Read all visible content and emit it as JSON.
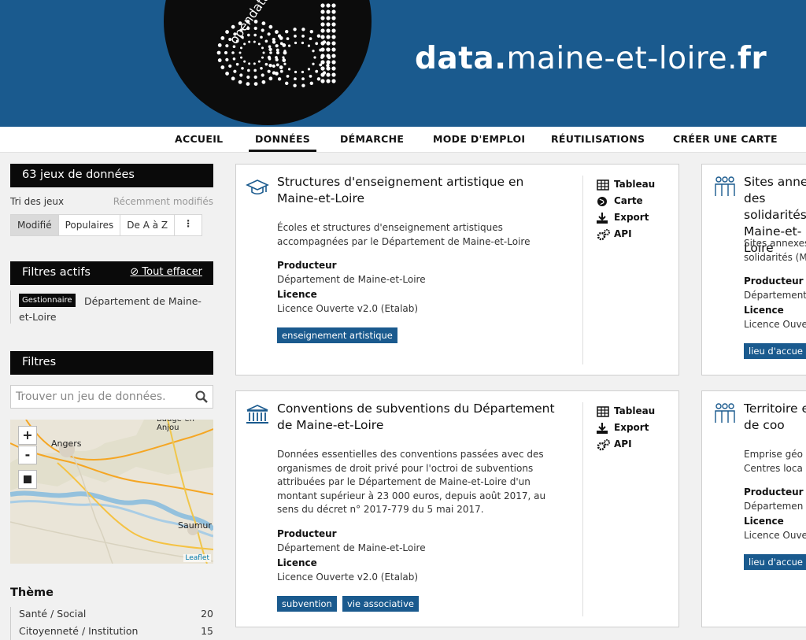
{
  "header": {
    "logo_text": "opendata",
    "site_title_bold": "data.",
    "site_title_mid": "maine-et-loire.",
    "site_title_end": "fr"
  },
  "nav": [
    "ACCUEIL",
    "DONNÉES",
    "DÉMARCHE",
    "MODE D'EMPLOI",
    "RÉUTILISATIONS",
    "CRÉER UNE CARTE"
  ],
  "sidebar": {
    "count_label": "63 jeux de données",
    "sort_label": "Tri des jeux",
    "sort_current": "Récemment modifiés",
    "sort_options": [
      "Modifié",
      "Populaires",
      "De A à Z",
      "⋮"
    ],
    "active_filters_title": "Filtres actifs",
    "clear_all": "Tout effacer",
    "filter_tag": "Gestionnaire",
    "filter_value": "Département de Maine-et-Loire",
    "filters_title": "Filtres",
    "search_placeholder": "Trouver un jeu de données.",
    "map": {
      "zoom_in": "+",
      "zoom_out": "-",
      "labels": [
        "Angers",
        "Saumur",
        "Baugé-en-Anjou"
      ],
      "attribution": "Leaflet"
    },
    "theme_title": "Thème",
    "themes": [
      {
        "name": "Santé / Social",
        "count": "20"
      },
      {
        "name": "Citoyenneté / Institution",
        "count": "15"
      }
    ]
  },
  "cards": [
    {
      "title": "Structures d'enseignement artistique en Maine-et-Loire",
      "description": "Écoles et structures d'enseignement artistiques accompagnées par le Département de Maine-et-Loire",
      "producer_label": "Producteur",
      "producer": "Département de Maine-et-Loire",
      "license_label": "Licence",
      "license": "Licence Ouverte v2.0 (Etalab)",
      "keywords": [
        "enseignement artistique"
      ],
      "actions": [
        "Tableau",
        "Carte",
        "Export",
        "API"
      ]
    },
    {
      "title": "Conventions de subventions du Département de Maine-et-Loire",
      "description": "Données essentielles des conventions passées avec des organismes de droit privé pour l'octroi de subventions attribuées par le Département de Maine-et-Loire d'un montant supérieur à 23 000 euros, depuis août 2017, au sens du décret n° 2017-779 du 5 mai 2017.",
      "producer_label": "Producteur",
      "producer": "Département de Maine-et-Loire",
      "license_label": "Licence",
      "license": "Licence Ouverte v2.0 (Etalab)",
      "keywords": [
        "subvention",
        "vie associative"
      ],
      "actions": [
        "Tableau",
        "Export",
        "API"
      ]
    },
    {
      "title": "Sites annexes des solidarités en Maine-et-Loire",
      "description": "Sites annexes des solidarités (M",
      "producer_label": "Producteur",
      "producer": "Département",
      "license_label": "Licence",
      "license": "Licence Ouve",
      "keywords": [
        "lieu d'accue"
      ]
    },
    {
      "title": "Territoire et de coo",
      "description": "Emprise géo Centres loca",
      "producer_label": "Producteur",
      "producer": "Départemen",
      "license_label": "Licence",
      "license": "Licence Ouve",
      "keywords": [
        "lieu d'accue"
      ]
    }
  ]
}
